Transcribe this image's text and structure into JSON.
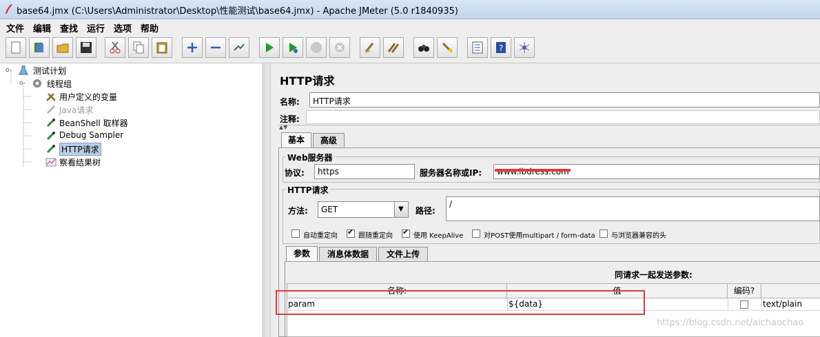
{
  "window": {
    "title": "base64.jmx (C:\\Users\\Administrator\\Desktop\\性能测试\\base64.jmx) - Apache JMeter (5.0 r1840935)"
  },
  "menu": [
    "文件",
    "编辑",
    "查找",
    "运行",
    "选项",
    "帮助"
  ],
  "toolbar": {
    "icons": [
      "new-icon",
      "templates-icon",
      "open-icon",
      "save-icon",
      "cut-icon",
      "copy-icon",
      "paste-icon",
      "expand-icon",
      "collapse-icon",
      "toggle-icon",
      "start-icon",
      "start-no-pause-icon",
      "stop-icon",
      "shutdown-icon",
      "clear-icon",
      "clear-all-icon",
      "search-icon",
      "reset-search-icon",
      "function-helper-icon",
      "help-icon",
      "remote-icon"
    ]
  },
  "tree": {
    "items": [
      {
        "label": "测试计划",
        "icon": "test-plan-icon",
        "disabled": false
      },
      {
        "label": "线程组",
        "icon": "thread-group-icon",
        "disabled": false
      },
      {
        "label": "用户定义的变量",
        "icon": "config-icon",
        "disabled": false
      },
      {
        "label": "Java请求",
        "icon": "sampler-icon",
        "disabled": true
      },
      {
        "label": "BeanShell 取样器",
        "icon": "sampler-icon",
        "disabled": false
      },
      {
        "label": "Debug Sampler",
        "icon": "sampler-icon",
        "disabled": false
      },
      {
        "label": "HTTP请求",
        "icon": "sampler-icon",
        "disabled": false,
        "selected": true
      },
      {
        "label": "察看结果树",
        "icon": "listener-icon",
        "disabled": false
      }
    ]
  },
  "http_request": {
    "title": "HTTP请求",
    "name_label": "名称:",
    "name_value": "HTTP请求",
    "comment_label": "注释:",
    "comment_value": "",
    "tabs": [
      "基本",
      "高级"
    ],
    "web_server": {
      "group_label": "Web服务器",
      "protocol_label": "协议:",
      "protocol_value": "https",
      "server_label": "服务器名称或IP:",
      "server_value": "www.lbdress.com"
    },
    "http_group_label": "HTTP请求",
    "method_label": "方法:",
    "method_value": "GET",
    "path_label": "路径:",
    "path_value": "/",
    "checkboxes": [
      {
        "label": "自动重定向",
        "checked": false
      },
      {
        "label": "跟随重定向",
        "checked": true
      },
      {
        "label": "使用 KeepAlive",
        "checked": true
      },
      {
        "label": "对POST使用multipart / form-data",
        "checked": false
      },
      {
        "label": "与浏览器兼容的头",
        "checked": false
      }
    ],
    "sub_tabs": [
      "参数",
      "消息体数据",
      "文件上传"
    ],
    "params_title": "同请求一起发送参数:",
    "table": {
      "headers": [
        "名称:",
        "值",
        "编码?",
        ""
      ],
      "rows": [
        {
          "name": "param",
          "value": "${data}",
          "encode": false,
          "content_type": "text/plain"
        }
      ]
    }
  },
  "watermark": "https://blog.csdn.net/aichaochao",
  "colors": {
    "highlight_red": "#e03a3a",
    "selection": "#b8cfe5"
  }
}
